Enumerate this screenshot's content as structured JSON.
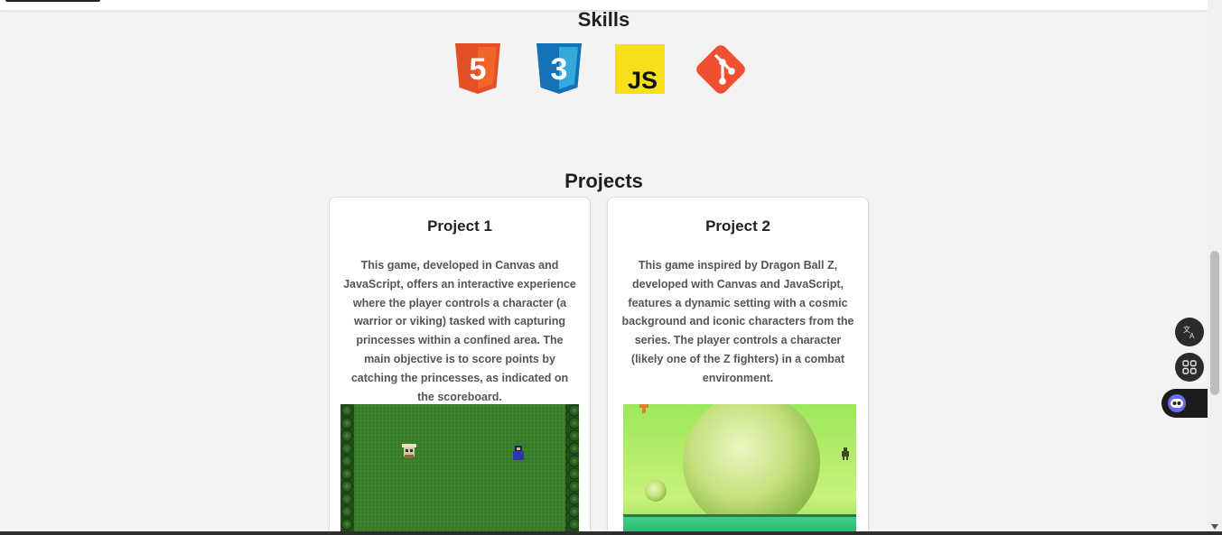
{
  "skills": {
    "title": "Skills",
    "items": [
      {
        "name": "html5-icon",
        "label": "5",
        "color": "#e34f26"
      },
      {
        "name": "css3-icon",
        "label": "3",
        "color": "#1572b6"
      },
      {
        "name": "javascript-icon",
        "label": "JS",
        "color": "#f7df1e"
      },
      {
        "name": "git-icon",
        "label": "",
        "color": "#f05032"
      }
    ]
  },
  "projects": {
    "title": "Projects",
    "items": [
      {
        "title": "Project 1",
        "description": "This game, developed in Canvas and JavaScript, offers an interactive experience where the player controls a character (a warrior or viking) tasked with capturing princesses within a confined area. The main objective is to score points by catching the princesses, as indicated on the scoreboard."
      },
      {
        "title": "Project 2",
        "description": "This game inspired by Dragon Ball Z, developed with Canvas and JavaScript, features a dynamic setting with a cosmic background and iconic characters from the series. The player controls a character (likely one of the Z fighters) in a combat environment."
      }
    ]
  },
  "floating": {
    "translate_icon": "translate-icon",
    "apps_icon": "apps-grid-icon",
    "bot_icon": "chatbot-icon"
  }
}
